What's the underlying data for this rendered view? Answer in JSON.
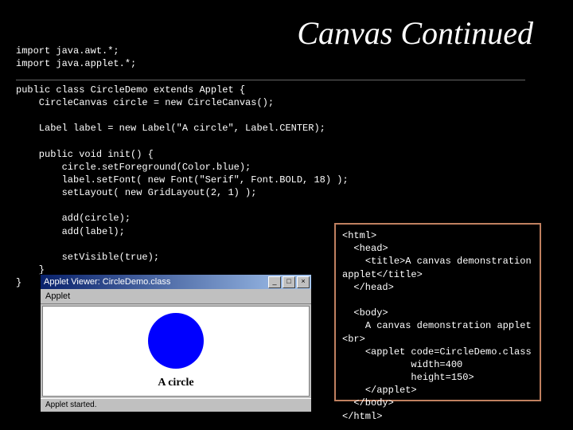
{
  "title": "Canvas Continued",
  "java_code": "import java.awt.*;\nimport java.applet.*;\n\npublic class CircleDemo extends Applet {\n    CircleCanvas circle = new CircleCanvas();\n\n    Label label = new Label(\"A circle\", Label.CENTER);\n\n    public void init() {\n        circle.setForeground(Color.blue);\n        label.setFont( new Font(\"Serif\", Font.BOLD, 18) );\n        setLayout( new GridLayout(2, 1) );\n\n        add(circle);\n        add(label);\n\n        setVisible(true);\n    }\n}",
  "applet": {
    "window_title": "Applet Viewer: CircleDemo.class",
    "menu_item": "Applet",
    "caption_label": "A circle",
    "status": "Applet started.",
    "min_glyph": "_",
    "max_glyph": "□",
    "close_glyph": "×"
  },
  "html_code": "<html>\n  <head>\n    <title>A canvas demonstration applet</title>\n  </head>\n\n  <body>\n    A canvas demonstration applet <br>\n    <applet code=CircleDemo.class\n            width=400\n            height=150>\n    </applet>\n  </body>\n</html>"
}
